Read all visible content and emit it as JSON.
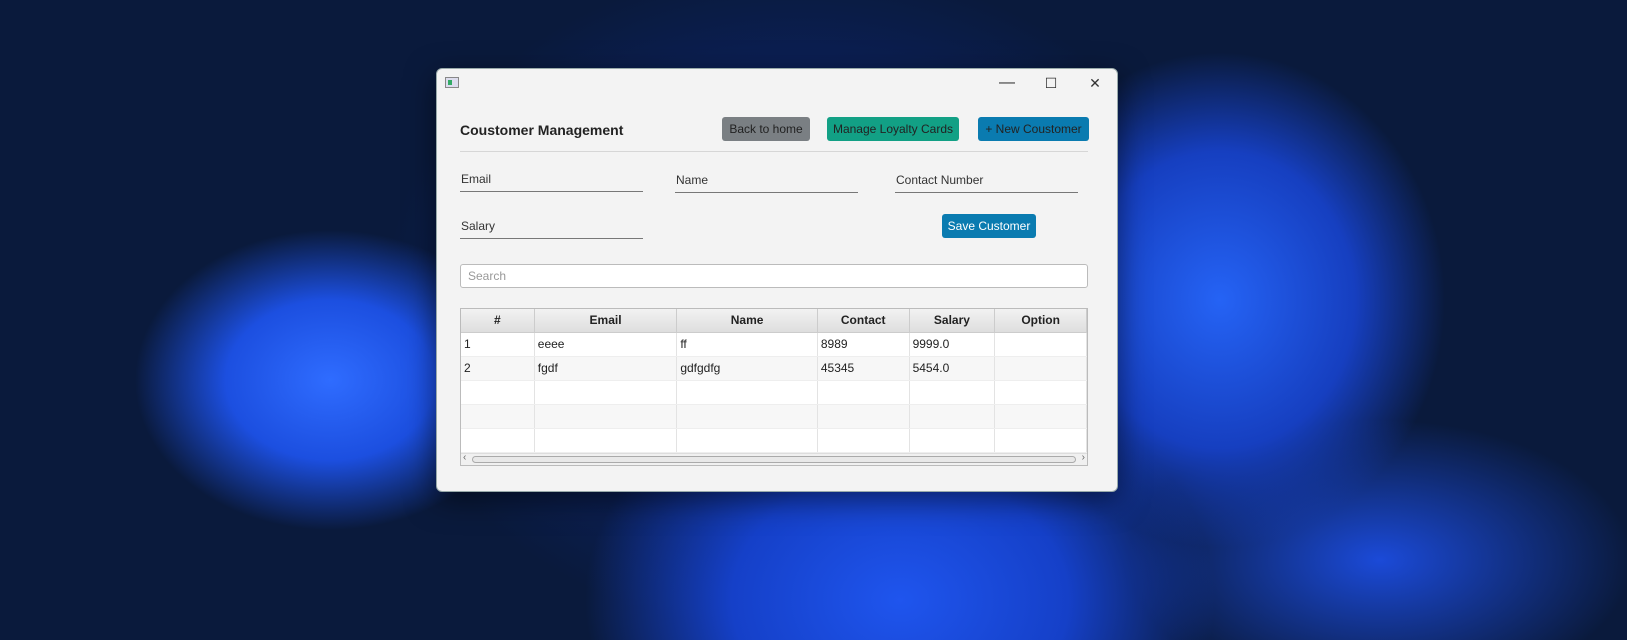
{
  "window": {
    "minimize": "—",
    "maximize": "☐",
    "close": "✕"
  },
  "header": {
    "title": "Coustomer Management",
    "back_label": "Back to home",
    "loyalty_label": "Manage Loyalty Cards",
    "new_label": "+ New Coustomer"
  },
  "form": {
    "email": "Email",
    "name": "Name",
    "contact": "Contact Number",
    "salary": "Salary",
    "save_label": "Save Customer"
  },
  "search": {
    "placeholder": "Search"
  },
  "colors": {
    "back": "#7a7f83",
    "loyalty": "#12a085",
    "primary": "#0a7bb0"
  },
  "table": {
    "columns": [
      "#",
      "Email",
      "Name",
      "Contact",
      "Salary",
      "Option"
    ],
    "rows": [
      [
        "1",
        "eeee",
        "ff",
        "8989",
        "9999.0",
        ""
      ],
      [
        "2",
        "fgdf",
        "gdfgdfg",
        "45345",
        "5454.0",
        ""
      ]
    ]
  }
}
